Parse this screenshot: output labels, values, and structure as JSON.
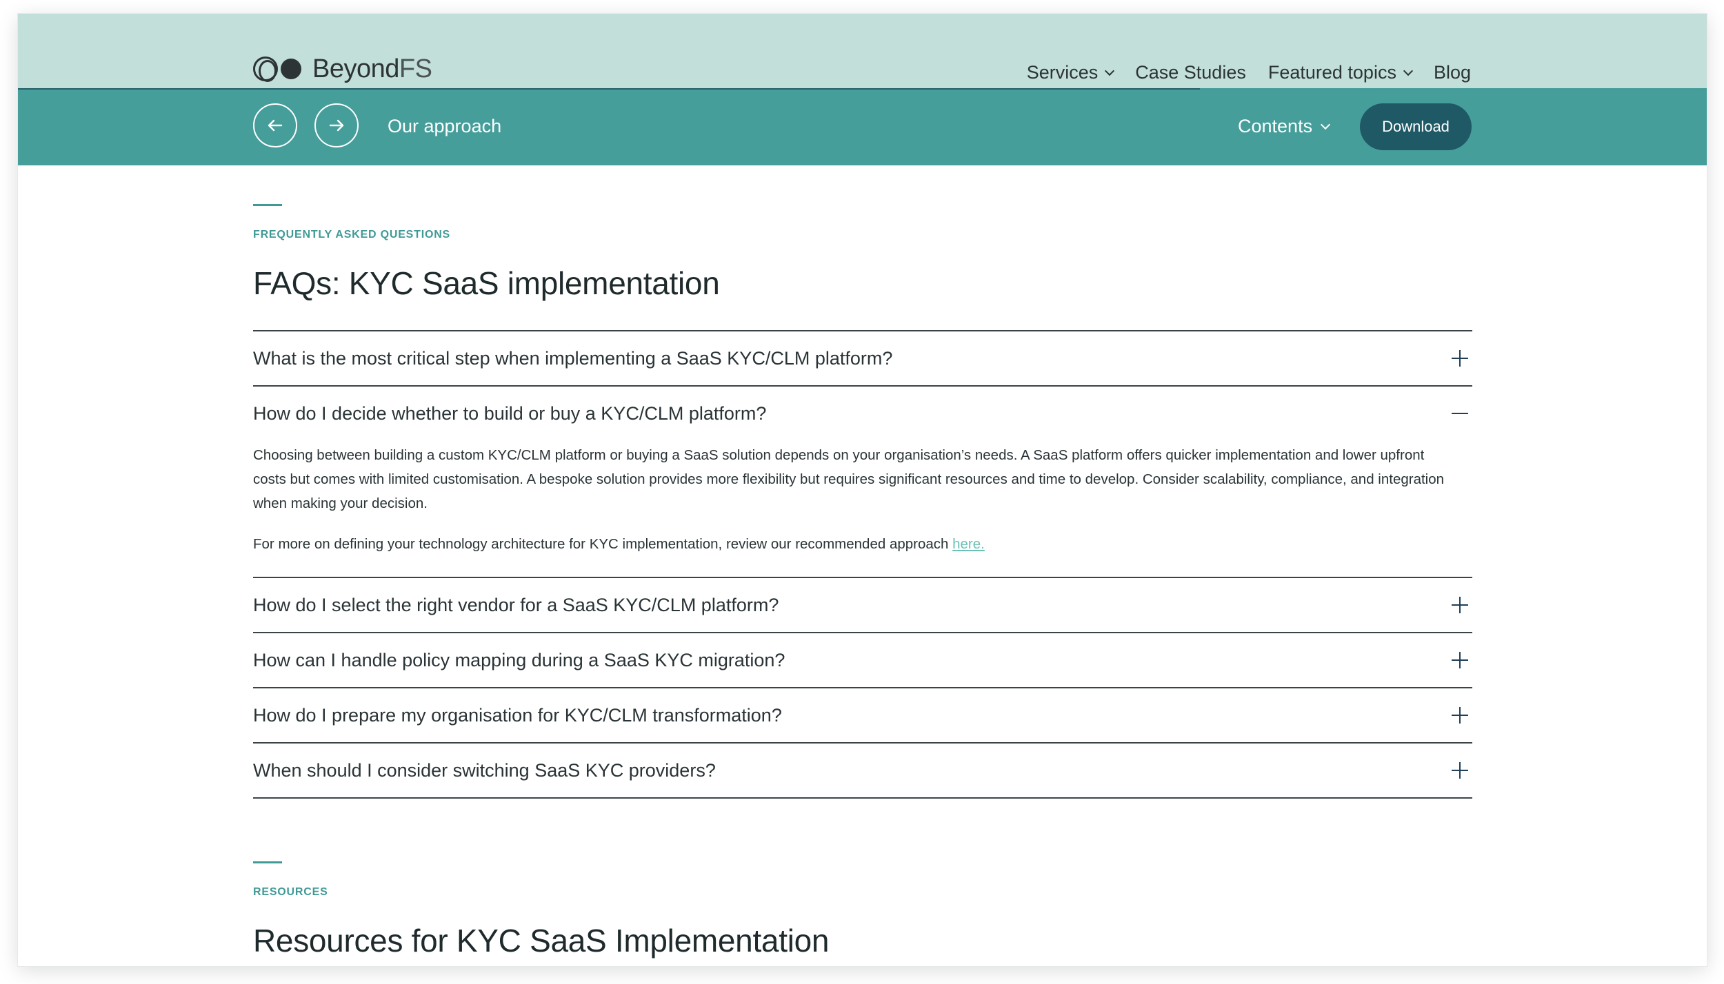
{
  "header": {
    "logo": {
      "name_main": "Beyond",
      "name_suffix": "FS"
    },
    "nav": [
      {
        "label": "Services",
        "dropdown": true
      },
      {
        "label": "Case Studies",
        "dropdown": false
      },
      {
        "label": "Featured topics",
        "dropdown": true
      },
      {
        "label": "Blog",
        "dropdown": false
      }
    ],
    "reading_progress": 0.7
  },
  "subbar": {
    "prev_icon": "arrow-left-icon",
    "next_icon": "arrow-right-icon",
    "section": "Our approach",
    "contents_label": "Contents",
    "download_label": "Download"
  },
  "faq": {
    "eyebrow": "FREQUENTLY ASKED QUESTIONS",
    "title": "FAQs: KYC SaaS implementation",
    "items": [
      {
        "question": "What is the most critical step when implementing a SaaS KYC/CLM platform?",
        "expanded": false
      },
      {
        "question": "How do I decide whether to build or buy a KYC/CLM platform?",
        "expanded": true,
        "answer": "Choosing between building a custom KYC/CLM platform or buying a SaaS solution depends on your organisation’s needs. A SaaS platform offers quicker implementation and lower upfront costs but comes with limited customisation. A bespoke solution provides more flexibility but requires significant resources and time to develop. Consider scalability, compliance, and integration when making your decision.",
        "followup": "For more on defining your technology architecture for KYC implementation, review our recommended approach ",
        "link_text": "here."
      },
      {
        "question": "How do I select the right vendor for a SaaS KYC/CLM platform?",
        "expanded": false
      },
      {
        "question": "How can I handle policy mapping during a SaaS KYC migration?",
        "expanded": false
      },
      {
        "question": "How do I prepare my organisation for KYC/CLM transformation?",
        "expanded": false
      },
      {
        "question": "When should I consider switching SaaS KYC providers?",
        "expanded": false
      }
    ]
  },
  "resources": {
    "eyebrow": "RESOURCES",
    "title": "Resources for KYC SaaS Implementation"
  },
  "colors": {
    "header_bg": "#c3dfda",
    "subbar_bg": "#469e9b",
    "accent": "#3f9a96",
    "download_bg": "#1f5966",
    "link": "#6cc0b6"
  }
}
